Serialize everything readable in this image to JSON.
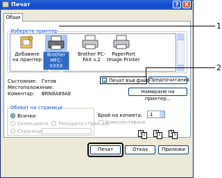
{
  "window": {
    "title": "Печат",
    "help_btn": "?",
    "close_btn": "X"
  },
  "tabs": [
    {
      "label": "Общи"
    }
  ],
  "printer_select": {
    "legend": "Изберете принтер",
    "items": [
      {
        "label": "Добавяне на принтер",
        "icon": "add-printer-icon"
      },
      {
        "label": "Brother MFC-XXXX Printer",
        "icon": "printer-icon",
        "selected": true
      },
      {
        "label": "Brother PC-FAX v.2",
        "icon": "fax-printer-icon"
      },
      {
        "label": "PaperPort Image Printer",
        "icon": "printer-icon"
      }
    ]
  },
  "status": {
    "state_label": "Състояние:",
    "state_value": "Готов",
    "location_label": "Местоположение:",
    "location_value": "",
    "comment_label": "Коментар:",
    "comment_value": "BRN8A89AE"
  },
  "print_to_file": {
    "label": "Печат във файл",
    "checked": true
  },
  "preferences_btn": "Предпочитания",
  "find_printer_btn": "Намиране на принтер...",
  "page_range": {
    "legend": "Обхват на страници",
    "options": [
      {
        "label": "Всички",
        "selected": true,
        "enabled": true
      },
      {
        "label": "Селекцията",
        "selected": false,
        "enabled": false
      },
      {
        "label": "Текущата страница",
        "selected": false,
        "enabled": false
      },
      {
        "label": "Страници:",
        "selected": false,
        "enabled": false
      }
    ]
  },
  "copies": {
    "label": "Брой на копията:",
    "value": "1",
    "collate_label": "Комплектоване",
    "collate_icons": [
      "1",
      "1",
      "2",
      "2",
      "3",
      "3"
    ]
  },
  "buttons": {
    "print": "Печат",
    "cancel": "Отказ",
    "apply": "Приложи"
  },
  "callouts": [
    "1",
    "2"
  ]
}
